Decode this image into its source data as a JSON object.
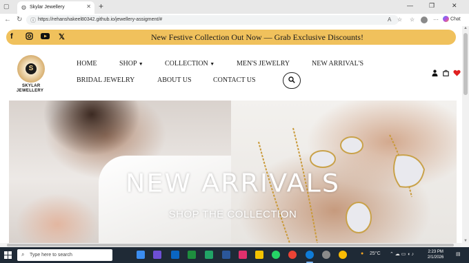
{
  "browser": {
    "tab_title": "Skylar Jewellery",
    "url": "https://rehanshakeel80342.github.io/jewellery-assigment/#",
    "chat_label": "Chat"
  },
  "promo": {
    "message": "New Festive Collection Out Now — Grab Exclusive Discounts!",
    "social_icons": [
      "facebook-icon",
      "instagram-icon",
      "youtube-icon",
      "x-icon"
    ]
  },
  "brand": {
    "line1": "SKYLAR",
    "line2": "JEWELLERY",
    "logo_letter": "S"
  },
  "nav": {
    "home": "HOME",
    "shop": "SHOP",
    "collection": "COLLECTION",
    "mens": "MEN'S JEWELRY",
    "new_arrivals": "NEW ARRIVAL'S",
    "bridal": "BRIDAL JEWELRY",
    "about": "ABOUT US",
    "contact": "CONTACT US"
  },
  "hero": {
    "title": "NEW ARRIVALS",
    "subtitle": "SHOP THE COLLECTION"
  },
  "taskbar": {
    "search_placeholder": "Type here to search",
    "weather": "25°C",
    "time": "2:23 PM",
    "date": "2/1/2026"
  },
  "colors": {
    "promo_bg": "#f0c15c",
    "heart": "#e02020",
    "taskbar": "#1f2a36"
  }
}
